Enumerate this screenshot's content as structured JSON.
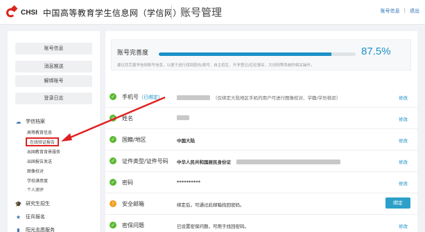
{
  "header": {
    "logo_text": "CHSI",
    "site_name": "中国高等教育学生信息网（学信网）",
    "page_title": "账号管理",
    "links": {
      "account_info": "账号信息",
      "separator": "|",
      "logout": "退出"
    }
  },
  "sidebar": {
    "buttons": [
      "账号信息",
      "消息推送",
      "解绑账号",
      "登录日志"
    ],
    "sections": [
      {
        "label": "学信档案",
        "icon": "cloud-icon"
      },
      {
        "label": "研究生招生",
        "icon": "graduation-cap-icon"
      },
      {
        "label": "征兵报名",
        "icon": "star-icon"
      },
      {
        "label": "阳光志愿服务",
        "icon": "bookmark-icon"
      }
    ],
    "sub_items": [
      "高等教育信息",
      "在线验证报告",
      "出国教育背景服务",
      "出国报告发送",
      "图像校对",
      "学校满意度",
      "个人测评"
    ]
  },
  "main": {
    "progress": {
      "label": "账号完善度",
      "value_text": "87.5%",
      "value": 0.875,
      "tip": "建议您完善学信网账号信息，以便于进行找回密码/换号、自主招生、升学登记/应征报名、大创网等系统的相关操作。"
    },
    "rows": [
      {
        "status": "ok",
        "label": "手机号",
        "hint": "（已绑定）",
        "note": "（仅绑定大陆地区手机的用户可进行图像校对、学籍/学历核验）",
        "action": "修改"
      },
      {
        "status": "ok",
        "label": "姓名",
        "value": "",
        "action": "修改"
      },
      {
        "status": "ok",
        "label": "国籍/地区",
        "value": "中国大陆",
        "action": "修改"
      },
      {
        "status": "ok",
        "label": "证件类型/证件号码",
        "value": "中华人民共和国居民身份证",
        "action": "修改"
      },
      {
        "status": "ok",
        "label": "密码",
        "value": "**********",
        "action": "修改"
      },
      {
        "status": "warn",
        "label": "安全邮箱",
        "value": "绑定后，可通过此邮箱找回密码。",
        "action": "绑定"
      },
      {
        "status": "ok",
        "label": "密保问题",
        "value": "已设置密保问题，可用于找回密码。",
        "action": "修改"
      }
    ]
  },
  "colors": {
    "accent": "#1b91c6",
    "ok": "#5bb832",
    "warn": "#f0a020",
    "brand_red": "#d9251d"
  }
}
